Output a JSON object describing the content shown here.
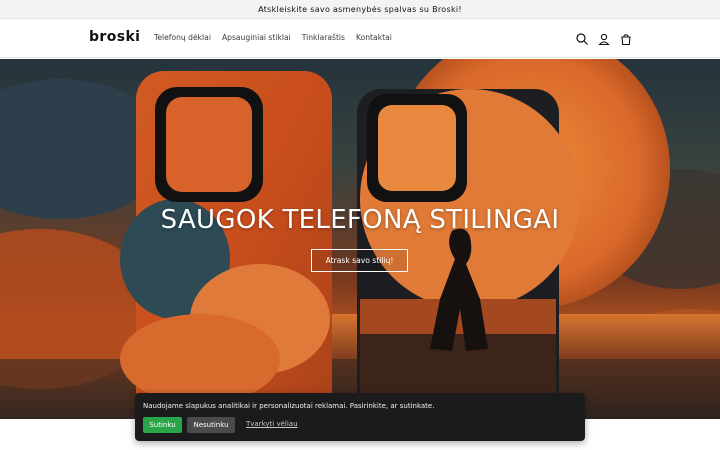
{
  "announcement": {
    "text": "Atskleiskite savo asmenybės spalvas su Broski!"
  },
  "header": {
    "logo": "broski",
    "nav": [
      "Telefonų dėklai",
      "Apsauginiai stiklai",
      "Tinklaraštis",
      "Kontaktai"
    ],
    "icons": [
      "search-icon",
      "account-icon",
      "cart-icon"
    ]
  },
  "hero": {
    "title": "SAUGOK TELEFONĄ STILINGAI",
    "button_label": "Atrask savo stilių!"
  },
  "cookie_banner": {
    "text": "Naudojame slapukus analitikai ir personalizuotai reklamai. Pasirinkite, ar sutinkate.",
    "accept_label": "Sutinku",
    "decline_label": "Nesutinku",
    "manage_label": "Tvarkyti vėliau",
    "accept_color": "#2aa64a"
  }
}
